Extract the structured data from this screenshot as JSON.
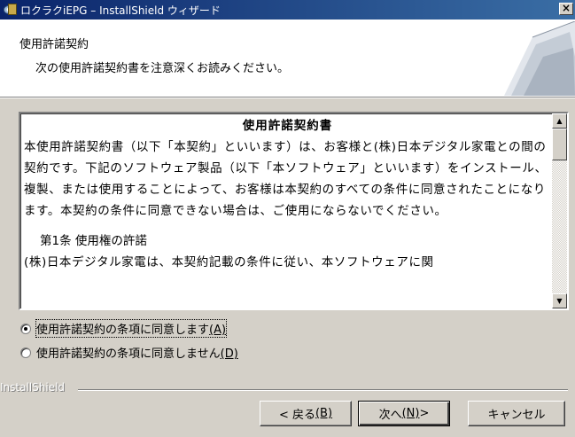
{
  "window": {
    "title": "ロクラクiEPG – InstallShield ウィザード",
    "close_label": "×"
  },
  "header": {
    "title": "使用許諾契約",
    "subtitle": "次の使用許諾契約書を注意深くお読みください。"
  },
  "license": {
    "heading": "使用許諾契約書",
    "paragraph": "本使用許諾契約書（以下「本契約」といいます）は、お客様と(株)日本デジタル家電との間の契約です。下記のソフトウェア製品（以下「本ソフトウェア」といいます）をインストール、複製、または使用することによって、お客様は本契約のすべての条件に同意されたことになります。本契約の条件に同意できない場合は、ご使用にならないでください。",
    "article_title": "第1条 使用権の許諾",
    "article_text": "(株)日本デジタル家電は、本契約記載の条件に従い、本ソフトウェアに関"
  },
  "options": {
    "accept_label": "使用許諾契約の条項に同意します",
    "accept_key": "(A)",
    "accept_checked": true,
    "decline_label": "使用許諾契約の条項に同意しません",
    "decline_key": "(D)"
  },
  "brand": "InstallShield",
  "buttons": {
    "back_label": "< 戻る",
    "back_key": "(B)",
    "next_label": "次へ",
    "next_key": "(N)",
    "next_suffix": " >",
    "cancel_label": "キャンセル"
  }
}
